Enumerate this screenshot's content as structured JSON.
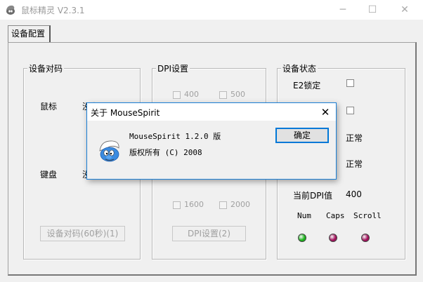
{
  "window": {
    "title": "鼠标精灵 V2.3.1",
    "minimize": "─",
    "maximize": "☐",
    "close": "✕"
  },
  "tabs": [
    {
      "label": "设备配置"
    }
  ],
  "pairing": {
    "group_title": "设备对码",
    "mouse_label": "鼠标",
    "mouse_status_partial": "没有",
    "keyboard_label": "键盘",
    "keyboard_status_partial": "没",
    "button_label": "设备对码(60秒)(1)"
  },
  "dpi": {
    "group_title": "DPI设置",
    "options_top": [
      "400",
      "500"
    ],
    "options_bottom": [
      "1600",
      "2000"
    ],
    "button_label": "DPI设置(2)"
  },
  "status": {
    "group_title": "设备状态",
    "e2_lock_label": "E2锁定",
    "status_1": "正常",
    "status_2": "正常",
    "current_dpi_label": "当前DPI值",
    "current_dpi_value": "400",
    "indicators": [
      {
        "label": "Num",
        "color": "#1bb31b"
      },
      {
        "label": "Caps",
        "color": "#a0105a"
      },
      {
        "label": "Scroll",
        "color": "#a0105a"
      }
    ]
  },
  "about_dialog": {
    "title": "关于 MouseSpirit",
    "line1": "MouseSpirit 1.2.0 版",
    "line2": "版权所有 (C) 2008",
    "ok_label": "确定",
    "close": "✕"
  }
}
